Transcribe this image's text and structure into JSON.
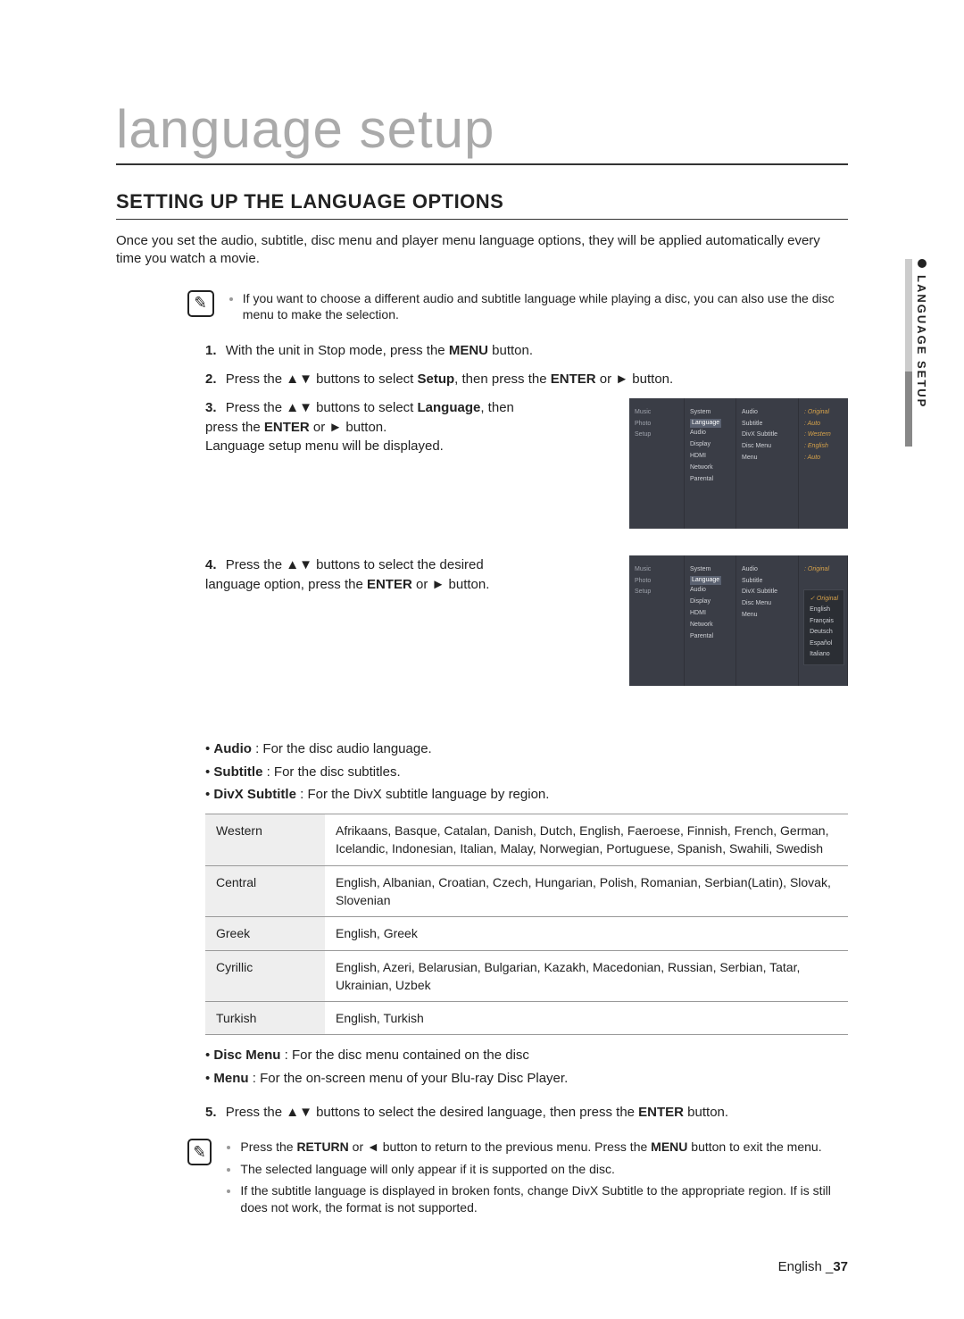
{
  "title": "language setup",
  "subtitle": "SETTING UP THE LANGUAGE OPTIONS",
  "intro": "Once you set the audio, subtitle, disc menu and player menu language options, they will be applied automatically every time you watch a movie.",
  "note1": "If you want to choose a different audio and subtitle language while playing a disc, you can also use the disc menu to make the selection.",
  "steps": {
    "s1": {
      "pre": "With the unit in Stop mode, press the ",
      "b1": "MENU",
      "post": " button."
    },
    "s2": {
      "pre": "Press the ",
      "arrows": "▲▼",
      "mid": " buttons to select ",
      "b1": "Setup",
      "mid2": ", then press the ",
      "b2": "ENTER",
      "or": " or ",
      "play": "►",
      "post": " button."
    },
    "s3": {
      "pre": "Press the ",
      "arrows": "▲▼",
      "mid": " buttons to select ",
      "b1": "Language",
      "mid2": ", then press the ",
      "b2": "ENTER",
      "or": " or ",
      "play": "►",
      "post": " button.",
      "sub": "Language setup menu will be displayed."
    },
    "s4": {
      "pre": "Press the ",
      "arrows": "▲▼",
      "mid": " buttons to select the desired language option, press the ",
      "b1": "ENTER",
      "or": " or ",
      "play": "►",
      "post": " button."
    },
    "s5": {
      "pre": "Press the ",
      "arrows": "▲▼",
      "mid": " buttons to select the desired language, then press the ",
      "b1": "ENTER",
      "post": " button."
    }
  },
  "optdesc": {
    "audio": {
      "b": "Audio",
      "t": " : For the disc audio language."
    },
    "subtitle": {
      "b": "Subtitle",
      "t": " : For the disc subtitles."
    },
    "divx": {
      "b": "DivX Subtitle",
      "t": " : For the DivX subtitle language by region."
    },
    "discmenu": {
      "b": "Disc Menu",
      "t": " : For the disc menu contained on the disc"
    },
    "menu": {
      "b": "Menu",
      "t": " : For the on-screen menu of your Blu-ray Disc Player."
    }
  },
  "table": [
    {
      "r": "Western",
      "v": "Afrikaans, Basque, Catalan, Danish, Dutch, English, Faeroese, Finnish, French, German, Icelandic, Indonesian, Italian, Malay, Norwegian, Portuguese, Spanish, Swahili, Swedish"
    },
    {
      "r": "Central",
      "v": "English, Albanian, Croatian, Czech, Hungarian, Polish, Romanian, Serbian(Latin), Slovak, Slovenian"
    },
    {
      "r": "Greek",
      "v": "English, Greek"
    },
    {
      "r": "Cyrillic",
      "v": "English, Azeri, Belarusian, Bulgarian, Kazakh, Macedonian, Russian, Serbian, Tatar, Ukrainian, Uzbek"
    },
    {
      "r": "Turkish",
      "v": "English, Turkish"
    }
  ],
  "note2": [
    {
      "pre": "Press the ",
      "b1": "RETURN",
      "mid": " or ",
      "arrow": "◄",
      "mid2": " button to return to the previous menu. Press the ",
      "b2": "MENU",
      "post": " button to exit the menu."
    },
    {
      "pre": "The selected language will only appear if it is supported on the disc.",
      "b1": "",
      "mid": "",
      "arrow": "",
      "mid2": "",
      "b2": "",
      "post": ""
    },
    {
      "pre": "If the subtitle language is displayed in broken fonts, change DivX Subtitle to the appropriate region. If is still does not work, the format is not supported.",
      "b1": "",
      "mid": "",
      "arrow": "",
      "mid2": "",
      "b2": "",
      "post": ""
    }
  ],
  "tab_label": "LANGUAGE SETUP",
  "footer": {
    "lang": "English _",
    "page": "37"
  },
  "sc1": {
    "col1": [
      "Music",
      "Photo",
      "Setup"
    ],
    "col2": [
      "System",
      "Language",
      "Audio",
      "Display",
      "HDMI",
      "Network",
      "Parental"
    ],
    "col2_hl_index": 1,
    "col3": [
      "Audio",
      "Subtitle",
      "DivX Subtitle",
      "Disc Menu",
      "Menu"
    ],
    "col4": [
      "Original",
      "Auto",
      "Western",
      "English",
      "Auto"
    ]
  },
  "sc2": {
    "col1": [
      "Music",
      "Photo",
      "Setup"
    ],
    "col2": [
      "System",
      "Language",
      "Audio",
      "Display",
      "HDMI",
      "Network",
      "Parental"
    ],
    "col2_hl_index": 1,
    "col3": [
      "Audio",
      "Subtitle",
      "DivX Subtitle",
      "Disc Menu",
      "Menu"
    ],
    "col4": [
      "Original"
    ],
    "dropdown": [
      "Original",
      "English",
      "Français",
      "Deutsch",
      "Español",
      "Italiano"
    ]
  }
}
